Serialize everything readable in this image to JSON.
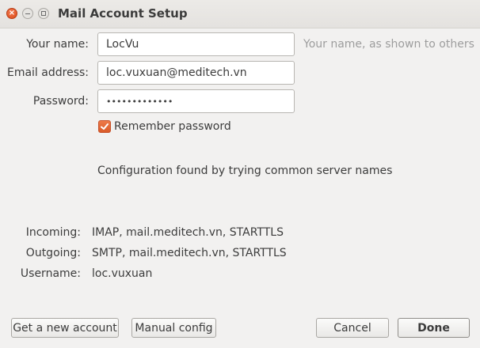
{
  "window": {
    "title": "Mail Account Setup"
  },
  "form": {
    "name_label": "Your name:",
    "name_value": "LocVu",
    "name_hint": "Your name, as shown to others",
    "email_label": "Email address:",
    "email_value": "loc.vuxuan@meditech.vn",
    "password_label": "Password:",
    "password_value": "•••••••••••••",
    "remember_label": "Remember password",
    "remember_checked": true
  },
  "status": {
    "message": "Configuration found by trying common server names"
  },
  "settings": {
    "incoming_label": "Incoming:",
    "incoming_value": "IMAP, mail.meditech.vn, STARTTLS",
    "outgoing_label": "Outgoing:",
    "outgoing_value": "SMTP, mail.meditech.vn, STARTTLS",
    "username_label": "Username:",
    "username_value": "loc.vuxuan"
  },
  "buttons": {
    "new_account": "Get a new account",
    "manual_config": "Manual config",
    "cancel": "Cancel",
    "done": "Done"
  },
  "colors": {
    "accent": "#dd4814",
    "background": "#f2f1f0"
  }
}
